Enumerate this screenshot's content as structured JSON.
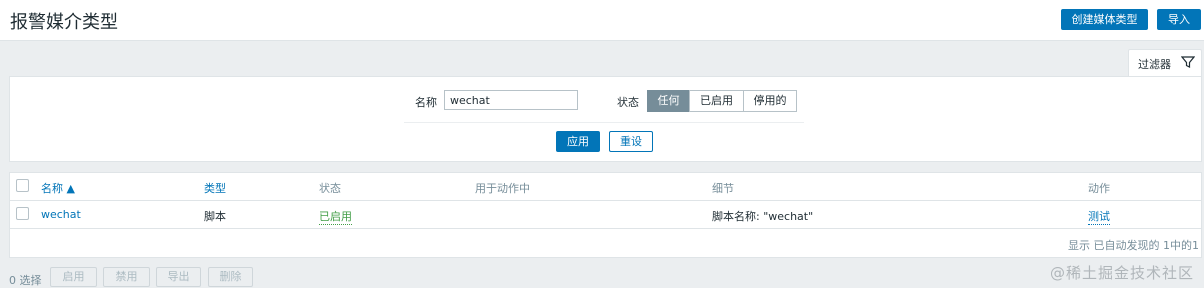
{
  "header": {
    "title": "报警媒介类型",
    "create_button": "创建媒体类型",
    "import_button": "导入"
  },
  "filter": {
    "tab_label": "过滤器",
    "name_label": "名称",
    "name_value": "wechat",
    "status_label": "状态",
    "status_options": [
      "任何",
      "已启用",
      "停用的"
    ],
    "status_selected": "任何",
    "apply_button": "应用",
    "reset_button": "重设"
  },
  "table": {
    "columns": {
      "name": "名称 ▲",
      "type": "类型",
      "status": "状态",
      "used_in_actions": "用于动作中",
      "details": "细节",
      "actions": "动作"
    },
    "rows": [
      {
        "name": "wechat",
        "type": "脚本",
        "status": "已启用",
        "used_in_actions": "",
        "details": "脚本名称: \"wechat\"",
        "action": "测试"
      }
    ],
    "paging": "显示 已自动发现的 1中的1"
  },
  "footer": {
    "selected_count": "0 选择",
    "buttons": [
      "启用",
      "禁用",
      "导出",
      "删除"
    ]
  },
  "watermark": "@稀土掘金技术社区",
  "colors": {
    "primary": "#0275b8",
    "enabled": "#429e47",
    "active_segment": "#768d99"
  }
}
